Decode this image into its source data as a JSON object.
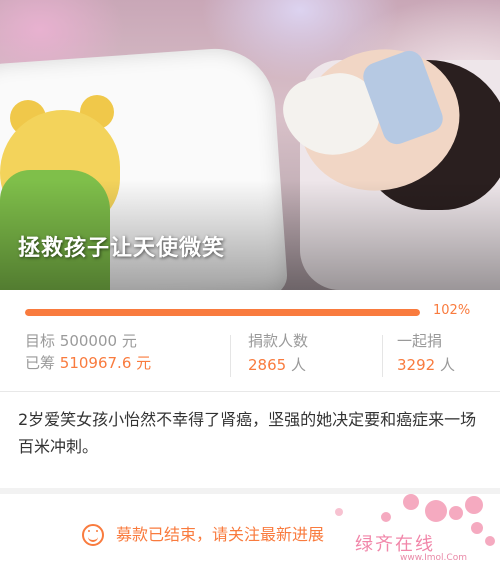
{
  "hero": {
    "title": "拯救孩子让天使微笑"
  },
  "progress": {
    "percent_label": "102%",
    "fraction": 1.0
  },
  "stats": {
    "goal_label": "目标",
    "goal_value": "500000",
    "goal_unit": "元",
    "raised_label": "已筹",
    "raised_value": "510967.6",
    "raised_unit": "元",
    "donors_label": "捐款人数",
    "donors_value": "2865",
    "donors_unit": "人",
    "together_label": "一起捐",
    "together_value": "3292",
    "together_unit": "人"
  },
  "description": "2岁爱笑女孩小怡然不幸得了肾癌，坚强的她决定要和癌症来一场百米冲刺。",
  "footer": {
    "end_text": "募款已结束，请关注最新进展"
  },
  "watermark": {
    "brand_text": "绿齐在线",
    "url_text": "www.Imol.Com"
  },
  "colors": {
    "accent": "#f97b3e",
    "muted": "#9a9a9a"
  },
  "icons": {
    "footer_icon": "smile-icon"
  }
}
